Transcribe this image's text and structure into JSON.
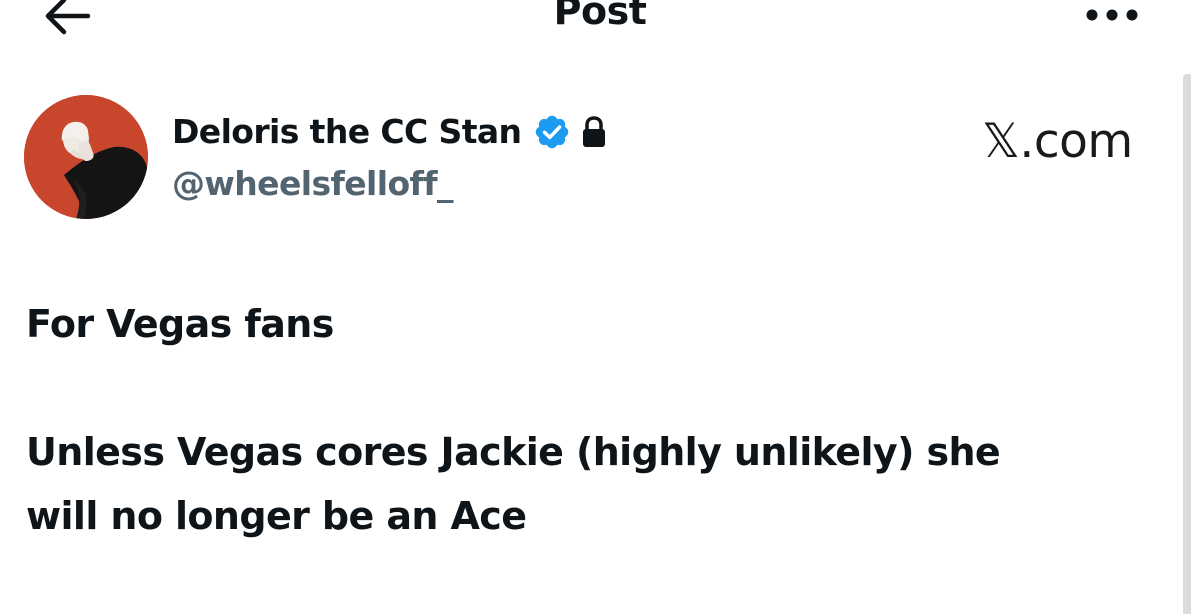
{
  "header": {
    "title": "Post",
    "back_icon": "arrow-left-icon",
    "more_icon": "more-dots-icon"
  },
  "author": {
    "display_name": "Deloris the CC Stan",
    "handle": "@wheelsfelloff_",
    "verified_icon": "verified-badge-icon",
    "protected_icon": "lock-icon",
    "avatar": "avatar-photo"
  },
  "watermark": {
    "logo_letter": "𝕏",
    "domain": ".com"
  },
  "post": {
    "line1": "For Vegas fans",
    "line2": "Unless Vegas cores Jackie (highly unlikely) she",
    "line3": "will no longer be an Ace"
  },
  "colors": {
    "text": "#0f1419",
    "secondary_text": "#536471",
    "verified_blue": "#1d9bf0",
    "avatar_background": "#c8472c"
  }
}
